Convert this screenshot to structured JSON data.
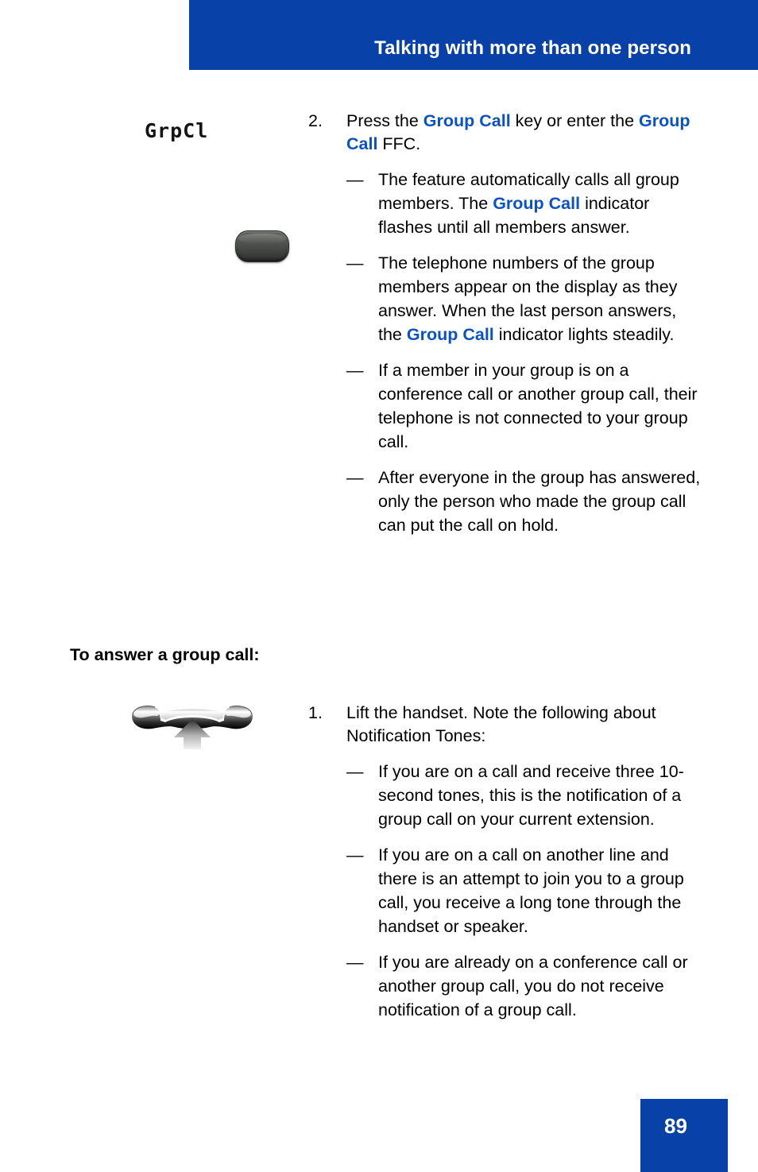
{
  "header": {
    "title": "Talking with more than one person",
    "band_color": "#0841a8"
  },
  "accent_color": "#0a53c4",
  "step_two": {
    "lcd_label": "GrpCl",
    "key_icon": "soft-key-button",
    "number": "2.",
    "text_parts": [
      {
        "text": "Press the ",
        "bold": false
      },
      {
        "text": "Group Call",
        "bold": true
      },
      {
        "text": " key or enter the ",
        "bold": false
      },
      {
        "text": "Group Call",
        "bold": true
      },
      {
        "text": " FFC.",
        "bold": false
      }
    ],
    "text_plain": "Press the Group Call key or enter the Group Call FFC.",
    "sub_items": [
      {
        "dash": "—",
        "parts": [
          {
            "text": "The feature automatically calls all group members. The ",
            "bold": false
          },
          {
            "text": "Group Call",
            "bold": true
          },
          {
            "text": " indicator flashes until all members answer.",
            "bold": false
          }
        ]
      },
      {
        "dash": "—",
        "parts": [
          {
            "text": "The telephone numbers of the group members appear on the display as they answer. When the last person answers, the ",
            "bold": false
          },
          {
            "text": "Group Call",
            "bold": true
          },
          {
            "text": " indicator lights steadily.",
            "bold": false
          }
        ]
      },
      {
        "dash": "—",
        "parts": [
          {
            "text": "If a member in your group is on a conference call or another group call, their telephone is not connected to your group call.",
            "bold": false
          }
        ]
      },
      {
        "dash": "—",
        "parts": [
          {
            "text": "After everyone in the group has answered, only the person who made the group call can put the call on hold.",
            "bold": false
          }
        ]
      }
    ]
  },
  "section_heading": "To answer a group call:",
  "step_one": {
    "handset_icon": "lift-handset-icon",
    "number": "1.",
    "text_parts": [
      {
        "text": "Lift the handset. Note the following about Notification Tones:",
        "bold": false
      }
    ],
    "text_plain": "Lift the handset. Note the following about Notification Tones:",
    "sub_items": [
      {
        "dash": "—",
        "parts": [
          {
            "text": "If you are on a call and receive three 10-second tones, this is the notification of a group call on your current extension.",
            "bold": false
          }
        ]
      },
      {
        "dash": "—",
        "parts": [
          {
            "text": "If you are on a call on another line and there is an attempt to join you to a group call, you receive a long tone through the handset or speaker.",
            "bold": false
          }
        ]
      },
      {
        "dash": "—",
        "parts": [
          {
            "text": "If you are already on a conference call or another group call, you do not receive notification of a group call.",
            "bold": false
          }
        ]
      }
    ]
  },
  "footer": {
    "page_number": "89",
    "box_color": "#0841a8"
  }
}
